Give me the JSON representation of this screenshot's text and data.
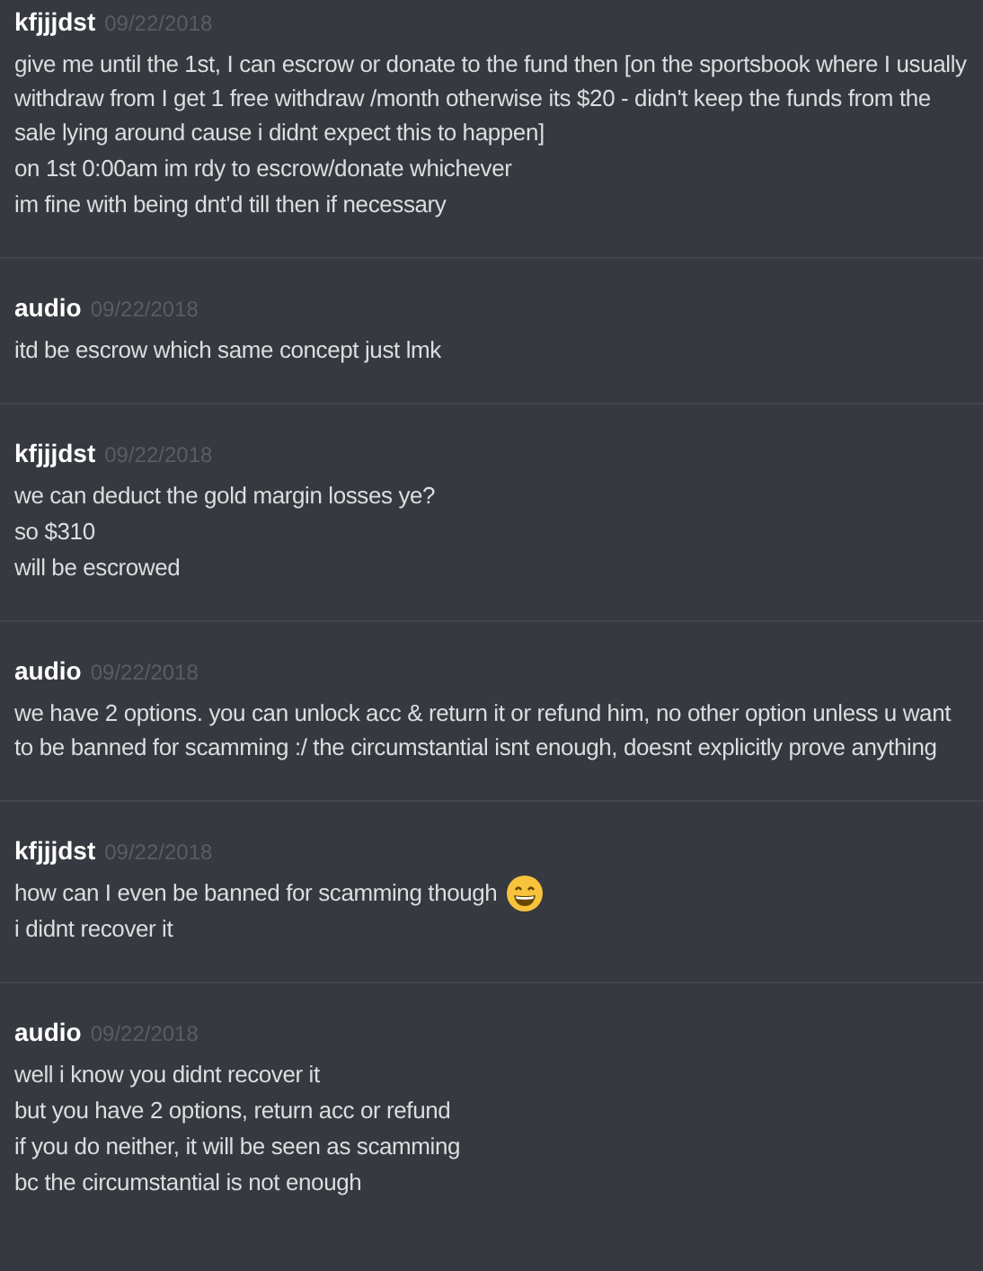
{
  "messages": [
    {
      "author": "kfjjjdst",
      "timestamp": "09/22/2018",
      "lines": [
        {
          "text": "give me until the 1st, I can escrow or donate to the fund then [on the sportsbook where I usually withdraw from I get 1 free withdraw /month otherwise its $20 - didn't keep the funds from the sale lying around cause i didnt expect this to happen]",
          "emoji": false
        },
        {
          "text": "on 1st 0:00am im rdy to escrow/donate whichever",
          "emoji": false
        },
        {
          "text": "im fine with being dnt'd till then if necessary",
          "emoji": false
        }
      ]
    },
    {
      "author": "audio",
      "timestamp": "09/22/2018",
      "lines": [
        {
          "text": "itd be escrow which same concept just lmk",
          "emoji": false
        }
      ]
    },
    {
      "author": "kfjjjdst",
      "timestamp": "09/22/2018",
      "lines": [
        {
          "text": "we can deduct the gold margin losses ye?",
          "emoji": false
        },
        {
          "text": "so $310",
          "emoji": false
        },
        {
          "text": "will be escrowed",
          "emoji": false
        }
      ]
    },
    {
      "author": "audio",
      "timestamp": "09/22/2018",
      "lines": [
        {
          "text": "we have 2 options. you can unlock acc & return it or refund him, no other option unless u want to be banned for scamming :/ the circumstantial isnt enough, doesnt explicitly prove anything",
          "emoji": false
        }
      ]
    },
    {
      "author": "kfjjjdst",
      "timestamp": "09/22/2018",
      "lines": [
        {
          "text": "how can I even be banned for scamming though",
          "emoji": true
        },
        {
          "text": "i didnt recover it",
          "emoji": false
        }
      ]
    },
    {
      "author": "audio",
      "timestamp": "09/22/2018",
      "lines": [
        {
          "text": "well i know you didnt recover it",
          "emoji": false
        },
        {
          "text": "but you have 2 options, return acc or refund",
          "emoji": false
        },
        {
          "text": "if you do neither, it will be seen as scamming",
          "emoji": false
        },
        {
          "text": "bc the circumstantial is not enough",
          "emoji": false
        }
      ]
    }
  ]
}
